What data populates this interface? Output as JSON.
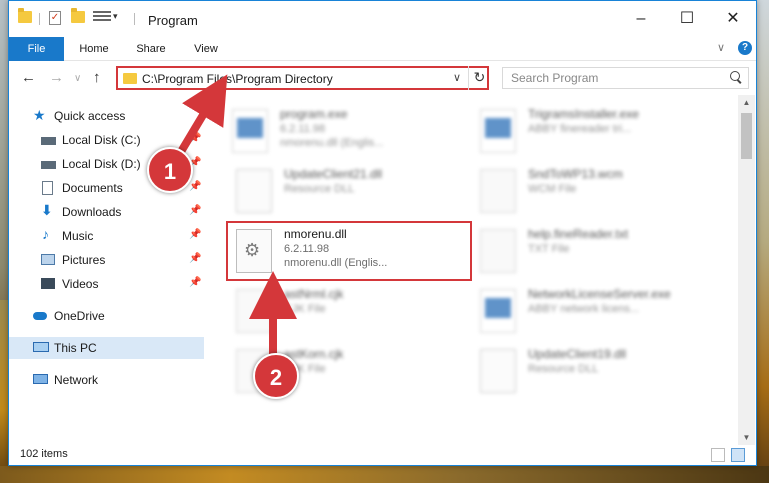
{
  "window": {
    "title": "Program"
  },
  "ribbon": {
    "tabs": [
      "File",
      "Home",
      "Share",
      "View"
    ],
    "help_label": "?"
  },
  "nav": {
    "address": "C:\\Program Files\\Program Directory",
    "search_placeholder": "Search Program"
  },
  "sidebar": {
    "items": [
      {
        "label": "Quick access",
        "icon": "star-icon",
        "pinned": false
      },
      {
        "label": "Local Disk (C:)",
        "icon": "drive-icon",
        "pinned": true
      },
      {
        "label": "Local Disk (D:)",
        "icon": "drive-icon",
        "pinned": true
      },
      {
        "label": "Documents",
        "icon": "documents-icon",
        "pinned": true
      },
      {
        "label": "Downloads",
        "icon": "download-icon",
        "pinned": true
      },
      {
        "label": "Music",
        "icon": "music-icon",
        "pinned": true
      },
      {
        "label": "Pictures",
        "icon": "pictures-icon",
        "pinned": true
      },
      {
        "label": "Videos",
        "icon": "videos-icon",
        "pinned": true
      },
      {
        "label": "OneDrive",
        "icon": "cloud-icon",
        "pinned": false
      },
      {
        "label": "This PC",
        "icon": "computer-icon",
        "pinned": false,
        "selected": true
      },
      {
        "label": "Network",
        "icon": "network-icon",
        "pinned": false
      }
    ]
  },
  "files": [
    {
      "name": "program.exe",
      "line2": "6.2.11.98",
      "line3": "nmorenu.dll (Englis...",
      "icon": "installer-icon",
      "blurred": true
    },
    {
      "name": "TrigramsInstaller.exe",
      "line2": "ABBY finereader tri...",
      "line3": "",
      "icon": "application-icon",
      "blurred": true
    },
    {
      "name": "UpdateClient21.dll",
      "line2": "Resource DLL",
      "line3": "",
      "icon": "dll-gear-icon",
      "blurred": true
    },
    {
      "name": "SndToWP13.wcm",
      "line2": "WCM File",
      "line3": "",
      "icon": "file-icon",
      "blurred": true
    },
    {
      "name": "nmorenu.dll",
      "line2": "6.2.11.98",
      "line3": "nmorenu.dll (Englis...",
      "icon": "dll-gear-icon",
      "blurred": false
    },
    {
      "name": "help.fineReader.txt",
      "line2": "TXT File",
      "line3": "",
      "icon": "file-icon",
      "blurred": true
    },
    {
      "name": "astNrml.cjk",
      "line2": "CJK File",
      "line3": "",
      "icon": "file-icon",
      "blurred": true
    },
    {
      "name": "NetworkLicenseServer.exe",
      "line2": "ABBY network licens...",
      "line3": "",
      "icon": "application-icon",
      "blurred": true
    },
    {
      "name": "astKorn.cjk",
      "line2": "CJK File",
      "line3": "",
      "icon": "file-icon",
      "blurred": true
    },
    {
      "name": "UpdateClient19.dll",
      "line2": "Resource DLL",
      "line3": "",
      "icon": "dll-gear-icon",
      "blurred": true
    }
  ],
  "status": {
    "item_count": "102 items"
  },
  "annotations": {
    "badge1": "1",
    "badge2": "2"
  },
  "colors": {
    "accent": "#1979ca",
    "annotation_red": "#d4373a",
    "selection": "#d9e8f7"
  }
}
